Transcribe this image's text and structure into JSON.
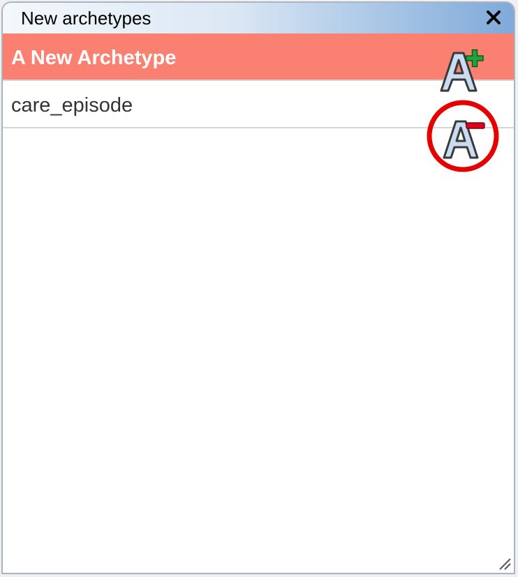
{
  "window": {
    "title": "New archetypes"
  },
  "controls": {
    "close_icon": "close-icon",
    "add_icon": "add-archetype-icon",
    "remove_icon": "remove-archetype-icon"
  },
  "list": {
    "items": [
      {
        "label": "A New Archetype",
        "selected": true
      },
      {
        "label": "care_episode",
        "selected": false
      }
    ]
  },
  "colors": {
    "selected_row": "#fa8072",
    "highlight_circle": "#e60000",
    "add_sign": "#1fa33a",
    "remove_sign": "#e0001b"
  }
}
